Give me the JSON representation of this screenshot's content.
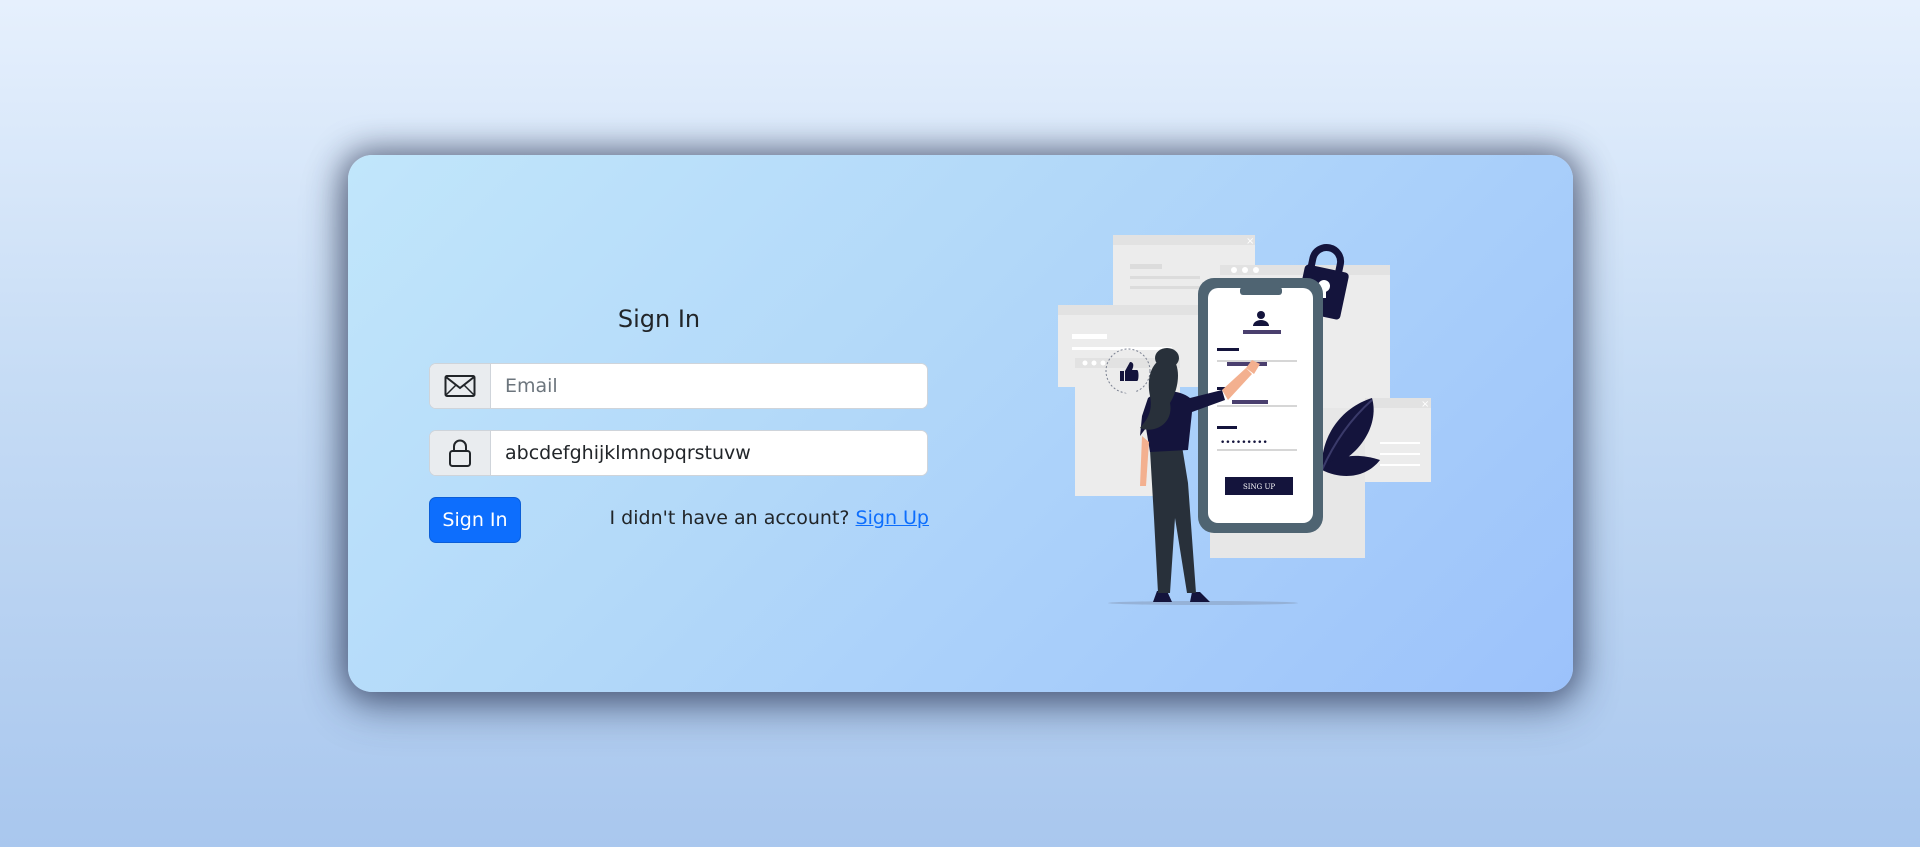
{
  "signin": {
    "title": "Sign In",
    "email_placeholder": "Email",
    "email_value": "",
    "password_value": "abcdefghijklmnopqrstuvw",
    "button_label": "Sign In",
    "account_prompt": "I didn't have an account?",
    "signup_link": "Sign Up"
  },
  "illustration": {
    "phone_button_label": "SING UP",
    "password_dots": "•••••••••"
  },
  "icons": {
    "email": "envelope-icon",
    "password": "lock-icon"
  },
  "colors": {
    "primary": "#0d6efd",
    "card_gradient_start": "#c1e6fb",
    "card_gradient_end": "#9cc2fb",
    "navy": "#14143c"
  }
}
